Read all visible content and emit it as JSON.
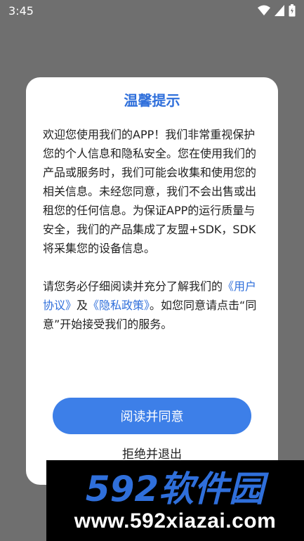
{
  "status_bar": {
    "time": "3:45",
    "icons": [
      "wifi-icon",
      "cellular-signal-icon",
      "battery-icon"
    ]
  },
  "dialog": {
    "title": "温馨提示",
    "paragraph1": "欢迎您使用我们的APP！我们非常重视保护您的个人信息和隐私安全。您在使用我们的产品或服务时，我们可能会收集和使用您的相关信息。未经您同意，我们不会出售或出租您的任何信息。为保证APP的运行质量与安全，我们的产品集成了友盟+SDK，SDK将采集您的设备信息。",
    "paragraph2_prefix": "请您务必仔细阅读并充分了解我们的",
    "user_agreement_link": "《用户协议》",
    "and_text": "及",
    "privacy_policy_link": "《隐私政策》",
    "paragraph2_suffix": "。如您同意请点击“同意”开始接受我们的服务。",
    "agree_button_label": "阅读并同意",
    "reject_label": "拒绝并退出"
  },
  "watermark": {
    "logo_text": "592软件园",
    "url": "www.592xiazai.com"
  },
  "colors": {
    "accent": "#2f6fdb",
    "button": "#3d7fe8",
    "overlay": "#6f6f6f",
    "watermark_logo": "#2f6fdb"
  }
}
